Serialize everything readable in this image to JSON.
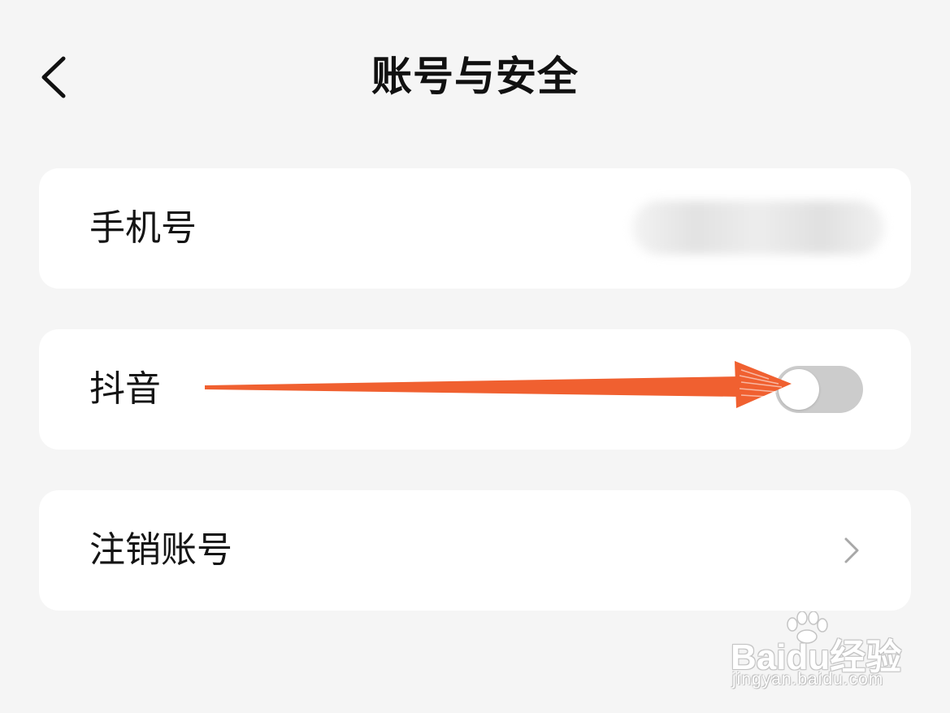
{
  "header": {
    "title": "账号与安全",
    "back_icon": "chevron-left-icon"
  },
  "settings": {
    "phone": {
      "label": "手机号",
      "value_blurred": true
    },
    "douyin": {
      "label": "抖音",
      "toggle_on": false,
      "toggle_color_off": "#cccccc"
    },
    "cancel_account": {
      "label": "注销账号",
      "icon": "chevron-right-icon"
    }
  },
  "annotation": {
    "icon": "arrow-right-icon",
    "color": "#f06030"
  },
  "watermark": {
    "logo_text": "Baidu经验",
    "url": "jingyan.baidu.com"
  }
}
